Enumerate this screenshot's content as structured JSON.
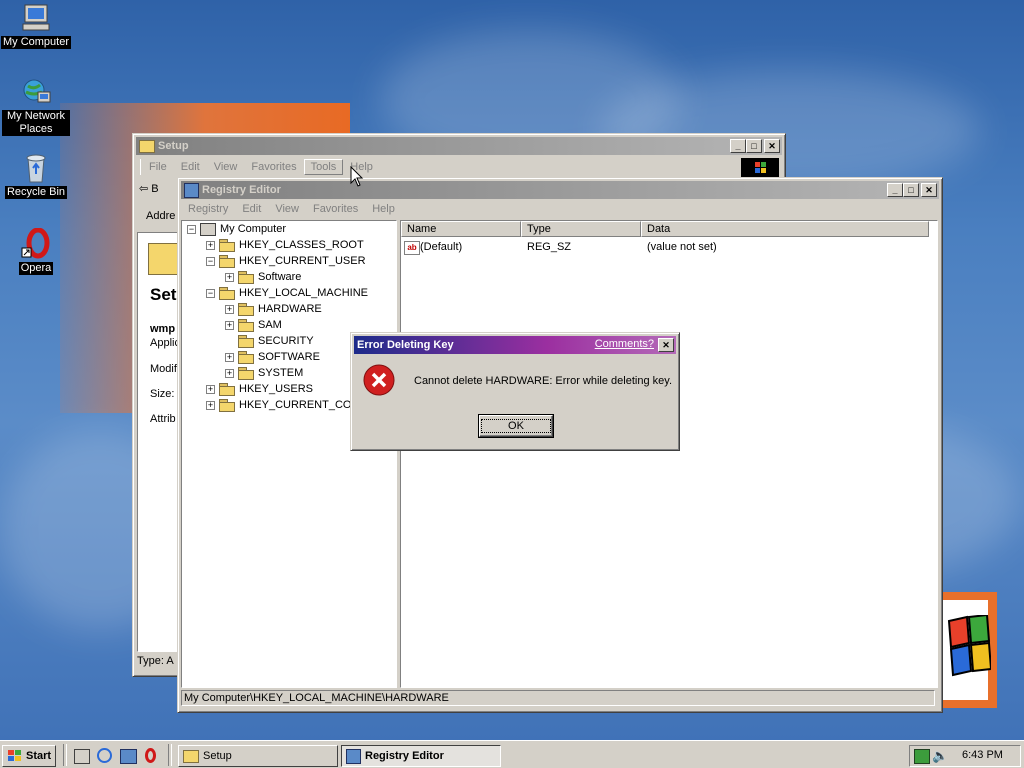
{
  "desktop": {
    "icons": [
      {
        "label": "My Computer"
      },
      {
        "label": "My Network Places"
      },
      {
        "label": "Recycle Bin"
      },
      {
        "label": "Opera"
      }
    ]
  },
  "setup_window": {
    "title": "Setup",
    "menu": [
      "File",
      "Edit",
      "View",
      "Favorites",
      "Tools",
      "Help"
    ],
    "back_label": "B",
    "address_label": "Addre",
    "panel_title": "Set",
    "panel_lines": [
      "wmp",
      "Applic",
      "Modif",
      "Size:",
      "Attrib"
    ],
    "status": "Type: A"
  },
  "regedit": {
    "title": "Registry Editor",
    "menu": [
      "Registry",
      "Edit",
      "View",
      "Favorites",
      "Help"
    ],
    "tree": [
      {
        "label": "My Computer",
        "sign": "−"
      },
      {
        "label": "HKEY_CLASSES_ROOT",
        "sign": "+"
      },
      {
        "label": "HKEY_CURRENT_USER",
        "sign": "−"
      },
      {
        "label": "Software",
        "sign": "+"
      },
      {
        "label": "HKEY_LOCAL_MACHINE",
        "sign": "−"
      },
      {
        "label": "HARDWARE",
        "sign": "+"
      },
      {
        "label": "SAM",
        "sign": "+"
      },
      {
        "label": "SECURITY",
        "sign": ""
      },
      {
        "label": "SOFTWARE",
        "sign": "+"
      },
      {
        "label": "SYSTEM",
        "sign": "+"
      },
      {
        "label": "HKEY_USERS",
        "sign": "+"
      },
      {
        "label": "HKEY_CURRENT_CONF",
        "sign": "+"
      }
    ],
    "columns": [
      "Name",
      "Type",
      "Data"
    ],
    "rows": [
      {
        "name": "(Default)",
        "type": "REG_SZ",
        "data": "(value not set)"
      }
    ],
    "status": "My Computer\\HKEY_LOCAL_MACHINE\\HARDWARE"
  },
  "dialog": {
    "title": "Error Deleting Key",
    "comments_link": "Comments?",
    "close": "✕",
    "message": "Cannot delete HARDWARE:  Error while deleting key.",
    "ok_label": "OK"
  },
  "taskbar": {
    "start_label": "Start",
    "tasks": [
      {
        "label": "Setup"
      },
      {
        "label": "Registry Editor"
      }
    ],
    "clock": "6:43 PM"
  },
  "colors": {
    "active_title_start": "#0a246a",
    "active_title_end": "#a6caf0",
    "dialog_title_start": "#1d2b8a",
    "dialog_title_end": "#9b2fa0",
    "error_red": "#d02020",
    "link_blue": "#0000ee"
  }
}
